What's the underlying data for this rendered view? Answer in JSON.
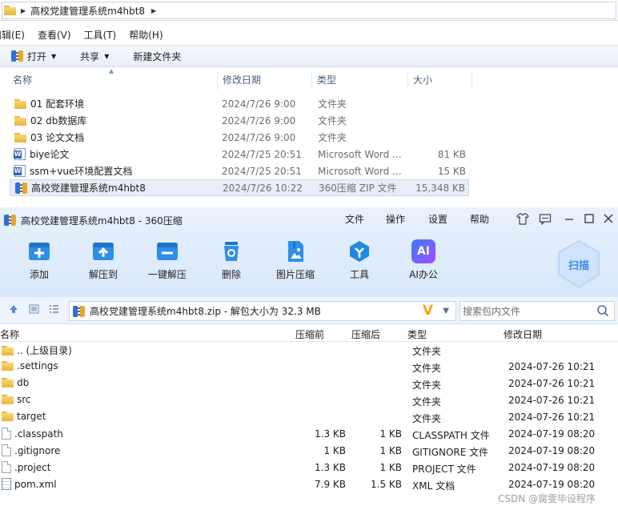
{
  "explorer": {
    "address": {
      "path": "高校党建管理系统m4hbt8"
    },
    "menu": [
      "编辑(E)",
      "查看(V)",
      "工具(T)",
      "帮助(H)"
    ],
    "toolbar": {
      "open_label": "打开",
      "share_label": "共享",
      "new_folder_label": "新建文件夹"
    },
    "columns": {
      "name": "名称",
      "date": "修改日期",
      "type": "类型",
      "size": "大小"
    },
    "rows": [
      {
        "name": "01 配套环境",
        "date": "2024/7/26 9:00",
        "type": "文件夹",
        "size": "",
        "icon": "folder-icon"
      },
      {
        "name": "02 db数据库",
        "date": "2024/7/26 9:00",
        "type": "文件夹",
        "size": "",
        "icon": "folder-icon"
      },
      {
        "name": "03 论文文档",
        "date": "2024/7/26 9:00",
        "type": "文件夹",
        "size": "",
        "icon": "folder-icon"
      },
      {
        "name": "biye论文",
        "date": "2024/7/25 20:51",
        "type": "Microsoft Word ...",
        "size": "81 KB",
        "icon": "word-doc-icon"
      },
      {
        "name": "ssm+vue环境配置文档",
        "date": "2024/7/25 20:51",
        "type": "Microsoft Word ...",
        "size": "15 KB",
        "icon": "word-doc-icon"
      },
      {
        "name": "高校党建管理系统m4hbt8",
        "date": "2024/7/26 10:22",
        "type": "360压缩 ZIP 文件",
        "size": "15,348 KB",
        "icon": "zip-icon"
      }
    ]
  },
  "zip": {
    "title": "高校党建管理系统m4hbt8 - 360压缩",
    "menu": [
      "文件",
      "操作",
      "设置",
      "帮助"
    ],
    "tools": [
      "添加",
      "解压到",
      "一键解压",
      "删除",
      "图片压缩",
      "工具",
      "AI办公"
    ],
    "ai_badge": "AI",
    "scan_label": "扫描",
    "path_text": "高校党建管理系统m4hbt8.zip - 解包大小为 32.3 MB",
    "search_placeholder": "搜索包内文件",
    "columns": {
      "name": "名称",
      "before": "压缩前",
      "after": "压缩后",
      "type": "类型",
      "date": "修改日期"
    },
    "rows": [
      {
        "name": ".. (上级目录)",
        "before": "",
        "after": "",
        "type": "文件夹",
        "date": "",
        "icon": "folder-icon"
      },
      {
        "name": ".settings",
        "before": "",
        "after": "",
        "type": "文件夹",
        "date": "2024-07-26 10:21",
        "icon": "folder-icon"
      },
      {
        "name": "db",
        "before": "",
        "after": "",
        "type": "文件夹",
        "date": "2024-07-26 10:21",
        "icon": "folder-icon"
      },
      {
        "name": "src",
        "before": "",
        "after": "",
        "type": "文件夹",
        "date": "2024-07-26 10:21",
        "icon": "folder-icon"
      },
      {
        "name": "target",
        "before": "",
        "after": "",
        "type": "文件夹",
        "date": "2024-07-26 10:21",
        "icon": "folder-icon"
      },
      {
        "name": ".classpath",
        "before": "1.3 KB",
        "after": "1 KB",
        "type": "CLASSPATH 文件",
        "date": "2024-07-19 08:20",
        "icon": "file-icon"
      },
      {
        "name": ".gitignore",
        "before": "1 KB",
        "after": "1 KB",
        "type": "GITIGNORE 文件",
        "date": "2024-07-19 08:20",
        "icon": "file-icon"
      },
      {
        "name": ".project",
        "before": "1.3 KB",
        "after": "1 KB",
        "type": "PROJECT 文件",
        "date": "2024-07-19 08:20",
        "icon": "file-icon"
      },
      {
        "name": "pom.xml",
        "before": "7.9 KB",
        "after": "1.5 KB",
        "type": "XML 文档",
        "date": "2024-07-19 08:20",
        "icon": "xml-icon"
      }
    ]
  },
  "watermark": "CSDN @腐雯毕设程序"
}
